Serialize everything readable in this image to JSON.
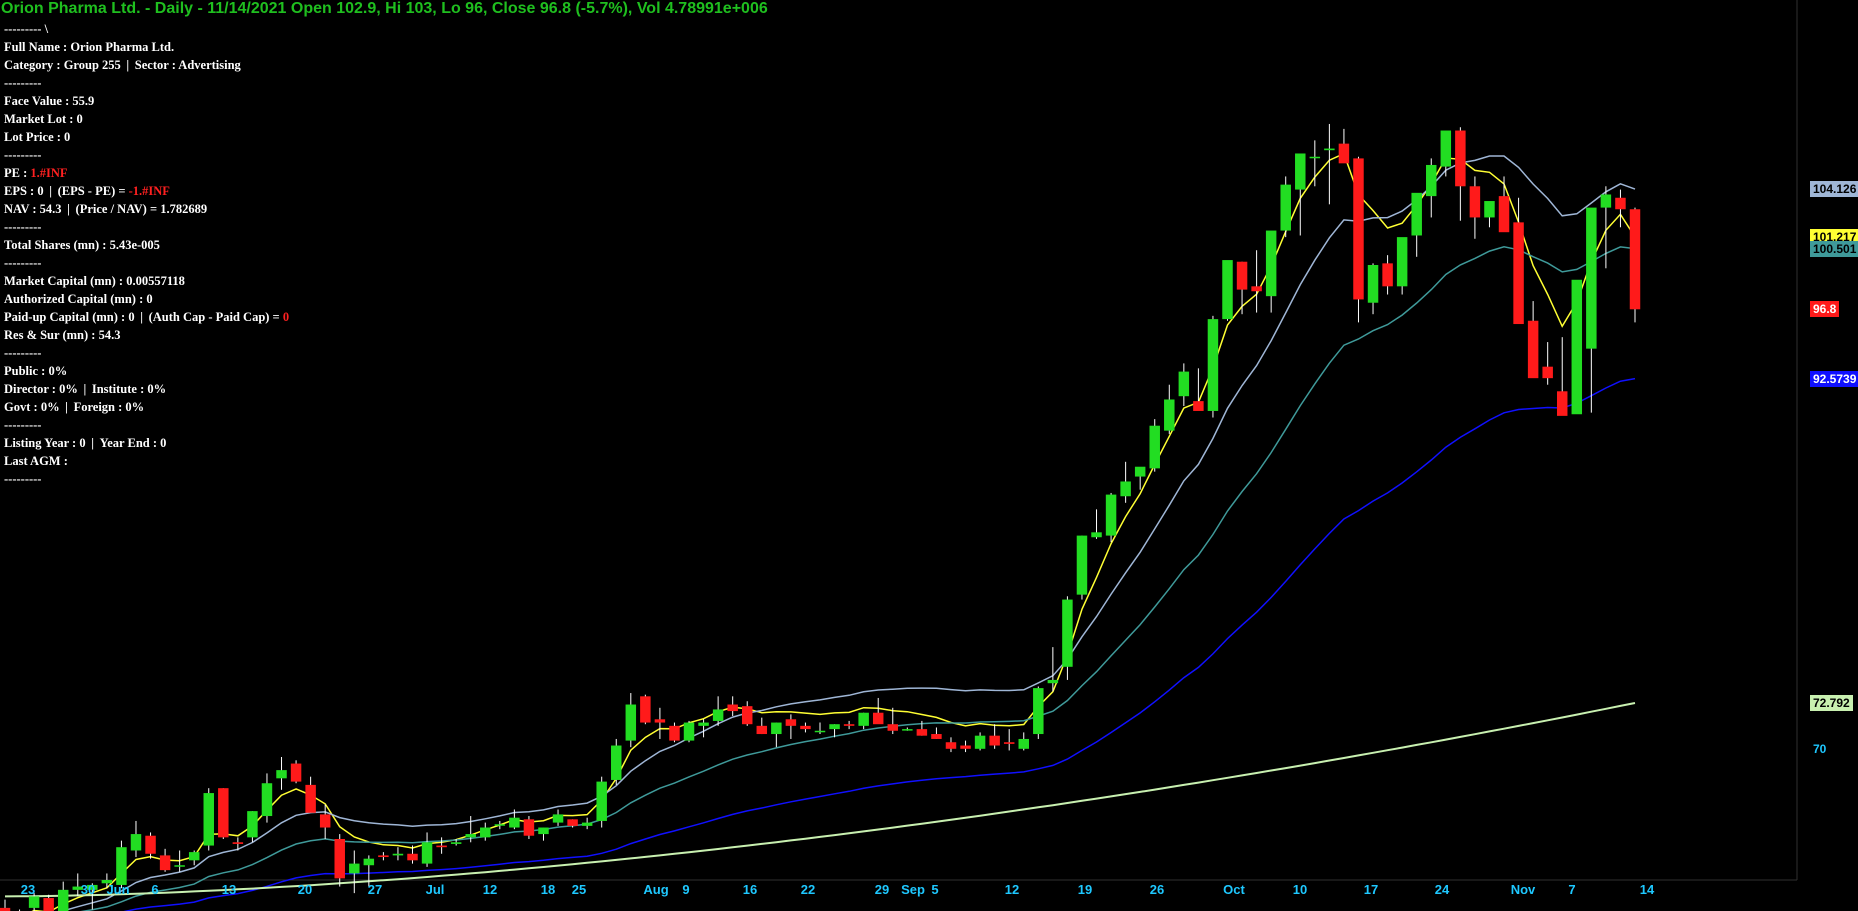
{
  "header": {
    "title": "Orion Pharma Ltd. - Daily - 11/14/2021 Open 102.9, Hi 103, Lo 96, Close 96.8 (-5.7%), Vol 4.78991e+006"
  },
  "info": {
    "line0": "--------- \\",
    "full_name_label": "Full Name :",
    "full_name": "Orion Pharma Ltd.",
    "category_label": "Category :",
    "category": "Group 255",
    "sector_label": "Sector :",
    "sector": "Advertising",
    "dash": "---------",
    "face_value_label": "Face Value :",
    "face_value": "55.9",
    "market_lot_label": "Market Lot :",
    "market_lot": "0",
    "lot_price_label": "Lot Price :",
    "lot_price": "0",
    "pe_label": "PE :",
    "pe": "1.#INF",
    "eps_label": "EPS :",
    "eps": "0",
    "eps_pe_label": "(EPS - PE) =",
    "eps_pe": "-1.#INF",
    "nav_label": "NAV :",
    "nav": "54.3",
    "price_nav_label": "(Price / NAV) =",
    "price_nav": "1.782689",
    "total_shares_label": "Total Shares (mn) :",
    "total_shares": "5.43e-005",
    "market_cap_label": "Market Capital (mn) :",
    "market_cap": "0.00557118",
    "auth_cap_label": "Authorized Capital (mn) :",
    "auth_cap": "0",
    "paidup_label": "Paid-up Capital (mn) :",
    "paidup": "0",
    "auth_paid_label": "(Auth Cap - Paid Cap) =",
    "auth_paid": "0",
    "res_sur_label": "Res & Sur (mn) :",
    "res_sur": "54.3",
    "public_label": "Public :",
    "public": "0%",
    "director_label": "Director :",
    "director": "0%",
    "institute_label": "Institute :",
    "institute": "0%",
    "govt_label": "Govt :",
    "govt": "0%",
    "foreign_label": "Foreign :",
    "foreign": "0%",
    "listing_year_label": "Listing Year :",
    "listing_year": "0",
    "year_end_label": "Year End :",
    "year_end": "0",
    "last_agm_label": "Last AGM :",
    "last_agm": ""
  },
  "price_labels": [
    {
      "text": "104.126",
      "value": 104.126,
      "bg": "#9fb6d6",
      "fg": "#000000"
    },
    {
      "text": "101.217",
      "value": 101.217,
      "bg": "#ffff33",
      "fg": "#000000"
    },
    {
      "text": "100.501",
      "value": 100.501,
      "bg": "#3f9a9a",
      "fg": "#000000"
    },
    {
      "text": "96.8",
      "value": 96.8,
      "bg": "#ff1a1a",
      "fg": "#ffffff"
    },
    {
      "text": "92.5739",
      "value": 92.5739,
      "bg": "#1010ff",
      "fg": "#ffffff"
    },
    {
      "text": "72.792",
      "value": 72.792,
      "bg": "#c8f0b0",
      "fg": "#000000"
    },
    {
      "text": "70",
      "value": 70,
      "bg": "",
      "fg": "#1ec8ff"
    }
  ],
  "x_ticks": [
    "23",
    "30",
    "Jun",
    "6",
    "13",
    "20",
    "27",
    "Jul",
    "12",
    "18",
    "25",
    "Aug",
    "9",
    "16",
    "22",
    "29",
    "Sep",
    "5",
    "12",
    "19",
    "26",
    "Oct",
    "10",
    "17",
    "24",
    "Nov",
    "7",
    "14"
  ],
  "chart_data": {
    "type": "candlestick",
    "title": "Orion Pharma Ltd. - Daily - 11/14/2021 Open 102.9, Hi 103, Lo 96, Close 96.8 (-5.7%), Vol 4.78991e+006",
    "colors": {
      "up": "#22dd22",
      "down": "#ff1a1a"
    },
    "y_range": [
      62,
      112
    ],
    "ohlc": [
      [
        60.3,
        60.8,
        59.4,
        59.5
      ],
      [
        59.6,
        60.2,
        59.2,
        60.0
      ],
      [
        60.3,
        61.2,
        60.1,
        61.0
      ],
      [
        60.9,
        61.1,
        59.6,
        59.8
      ],
      [
        59.7,
        61.9,
        59.6,
        61.4
      ],
      [
        61.4,
        62.4,
        61.0,
        61.6
      ],
      [
        61.4,
        61.8,
        60.2,
        61.7
      ],
      [
        61.8,
        62.4,
        61.5,
        62.0
      ],
      [
        61.7,
        64.4,
        61.5,
        64.0
      ],
      [
        63.8,
        65.6,
        63.4,
        64.8
      ],
      [
        64.7,
        64.9,
        63.3,
        63.6
      ],
      [
        63.5,
        63.9,
        62.5,
        62.6
      ],
      [
        62.9,
        63.8,
        62.5,
        62.9
      ],
      [
        63.2,
        63.8,
        62.9,
        63.7
      ],
      [
        64.1,
        67.6,
        63.8,
        67.3
      ],
      [
        67.6,
        67.6,
        64.5,
        64.6
      ],
      [
        64.3,
        64.6,
        63.8,
        64.2
      ],
      [
        64.6,
        66.2,
        64.3,
        66.2
      ],
      [
        65.9,
        68.5,
        65.5,
        67.9
      ],
      [
        68.2,
        69.5,
        67.5,
        68.7
      ],
      [
        69.1,
        69.3,
        67.9,
        68.0
      ],
      [
        67.8,
        68.3,
        66.1,
        66.1
      ],
      [
        66.0,
        66.6,
        64.5,
        65.2
      ],
      [
        64.5,
        64.8,
        61.6,
        62.1
      ],
      [
        62.4,
        63.8,
        61.2,
        63.0
      ],
      [
        62.9,
        63.5,
        61.6,
        63.3
      ],
      [
        63.5,
        63.7,
        63.2,
        63.4
      ],
      [
        63.5,
        64.0,
        63.2,
        63.6
      ],
      [
        63.6,
        64.1,
        63.0,
        63.2
      ],
      [
        63.0,
        64.9,
        62.8,
        64.3
      ],
      [
        64.1,
        64.6,
        63.6,
        64.0
      ],
      [
        64.2,
        64.5,
        64.1,
        64.3
      ],
      [
        64.6,
        65.9,
        64.3,
        64.8
      ],
      [
        64.6,
        65.5,
        64.4,
        65.2
      ],
      [
        65.4,
        65.6,
        65.1,
        65.4
      ],
      [
        65.2,
        66.3,
        65.1,
        65.8
      ],
      [
        65.7,
        65.9,
        64.5,
        64.7
      ],
      [
        64.8,
        65.2,
        64.4,
        65.2
      ],
      [
        65.5,
        66.3,
        65.3,
        66.0
      ],
      [
        65.7,
        65.7,
        65.2,
        65.3
      ],
      [
        65.3,
        65.8,
        65.1,
        65.5
      ],
      [
        65.6,
        68.3,
        65.2,
        68.0
      ],
      [
        68.1,
        70.6,
        67.8,
        70.2
      ],
      [
        70.5,
        73.4,
        70.1,
        72.7
      ],
      [
        73.2,
        73.3,
        71.5,
        71.6
      ],
      [
        71.8,
        72.5,
        70.6,
        71.6
      ],
      [
        71.4,
        71.6,
        70.4,
        70.5
      ],
      [
        70.5,
        71.7,
        70.4,
        71.6
      ],
      [
        71.4,
        71.8,
        70.7,
        71.6
      ],
      [
        71.7,
        73.2,
        71.4,
        72.4
      ],
      [
        72.7,
        73.2,
        72.0,
        72.3
      ],
      [
        72.6,
        72.9,
        71.4,
        71.5
      ],
      [
        71.4,
        71.9,
        70.9,
        70.9
      ],
      [
        70.9,
        71.6,
        70.1,
        71.6
      ],
      [
        71.8,
        72.1,
        70.6,
        71.4
      ],
      [
        71.4,
        71.6,
        71.0,
        71.2
      ],
      [
        71.1,
        71.6,
        70.9,
        71.1
      ],
      [
        71.2,
        71.5,
        70.7,
        71.5
      ],
      [
        71.5,
        71.7,
        71.2,
        71.4
      ],
      [
        71.4,
        72.2,
        71.2,
        72.2
      ],
      [
        72.2,
        73.1,
        71.7,
        71.5
      ],
      [
        71.5,
        72.5,
        70.9,
        71.1
      ],
      [
        71.2,
        71.3,
        71.1,
        71.2
      ],
      [
        71.2,
        71.7,
        70.8,
        70.8
      ],
      [
        70.9,
        71.3,
        70.6,
        70.6
      ],
      [
        70.4,
        70.7,
        69.8,
        70.0
      ],
      [
        70.2,
        70.5,
        69.8,
        70.0
      ],
      [
        70.0,
        71.0,
        69.9,
        70.8
      ],
      [
        70.8,
        71.5,
        70.0,
        70.2
      ],
      [
        70.4,
        71.2,
        69.9,
        70.3
      ],
      [
        70.0,
        71.0,
        69.9,
        70.6
      ],
      [
        70.9,
        73.8,
        70.6,
        73.7
      ],
      [
        74.0,
        76.2,
        73.5,
        74.2
      ],
      [
        75.0,
        79.3,
        74.2,
        79.1
      ],
      [
        79.4,
        83.0,
        79.1,
        83.0
      ],
      [
        82.9,
        84.6,
        82.8,
        83.2
      ],
      [
        83.0,
        85.6,
        82.6,
        85.5
      ],
      [
        85.4,
        87.5,
        85.0,
        86.3
      ],
      [
        86.6,
        87.1,
        85.8,
        87.2
      ],
      [
        87.1,
        90.1,
        86.9,
        89.7
      ],
      [
        89.4,
        92.2,
        89.2,
        91.3
      ],
      [
        91.5,
        93.5,
        90.9,
        93.0
      ],
      [
        91.2,
        93.2,
        91.0,
        90.6
      ],
      [
        90.6,
        96.4,
        90.2,
        96.2
      ],
      [
        96.2,
        97.3,
        96.1,
        99.8
      ],
      [
        99.7,
        99.7,
        96.5,
        98.0
      ],
      [
        98.2,
        100.4,
        96.6,
        97.9
      ],
      [
        97.6,
        100.5,
        96.6,
        101.6
      ],
      [
        101.6,
        104.9,
        101.2,
        104.4
      ],
      [
        104.1,
        104.7,
        101.3,
        106.3
      ],
      [
        106.1,
        107.1,
        104.3,
        106.1
      ],
      [
        106.5,
        108.1,
        103.2,
        106.6
      ],
      [
        106.9,
        107.8,
        106.2,
        105.7
      ],
      [
        106.0,
        106.1,
        96.0,
        97.4
      ],
      [
        97.2,
        99.6,
        96.5,
        99.5
      ],
      [
        99.6,
        100.1,
        97.7,
        98.2
      ],
      [
        98.2,
        100.0,
        97.7,
        101.2
      ],
      [
        101.3,
        101.9,
        100.0,
        103.9
      ],
      [
        103.7,
        106.0,
        102.4,
        105.6
      ],
      [
        105.5,
        106.1,
        104.9,
        107.7
      ],
      [
        107.7,
        107.9,
        102.2,
        104.3
      ],
      [
        104.3,
        104.9,
        101.1,
        102.4
      ],
      [
        102.4,
        103.3,
        101.8,
        103.4
      ],
      [
        103.7,
        104.9,
        102.7,
        101.5
      ],
      [
        102.1,
        103.6,
        99.7,
        95.9
      ],
      [
        96.1,
        97.3,
        93.3,
        92.6
      ],
      [
        93.3,
        94.8,
        92.2,
        92.6
      ],
      [
        91.8,
        95.1,
        90.5,
        90.3
      ],
      [
        90.4,
        93.9,
        90.5,
        98.6
      ],
      [
        94.4,
        99.3,
        90.5,
        103.0
      ],
      [
        103.0,
        104.3,
        99.3,
        103.8
      ],
      [
        103.6,
        104.1,
        101.8,
        102.9
      ],
      [
        102.9,
        103.0,
        96.0,
        96.8
      ]
    ],
    "moving_averages": [
      {
        "color": "#ffff33",
        "value": 101.217
      },
      {
        "color": "#9fb6d6",
        "value": 104.126
      },
      {
        "color": "#3f9a9a",
        "value": 100.501
      },
      {
        "color": "#1010ff",
        "value": 92.5739
      },
      {
        "color": "#c8f0b0",
        "value": 72.792
      }
    ]
  }
}
